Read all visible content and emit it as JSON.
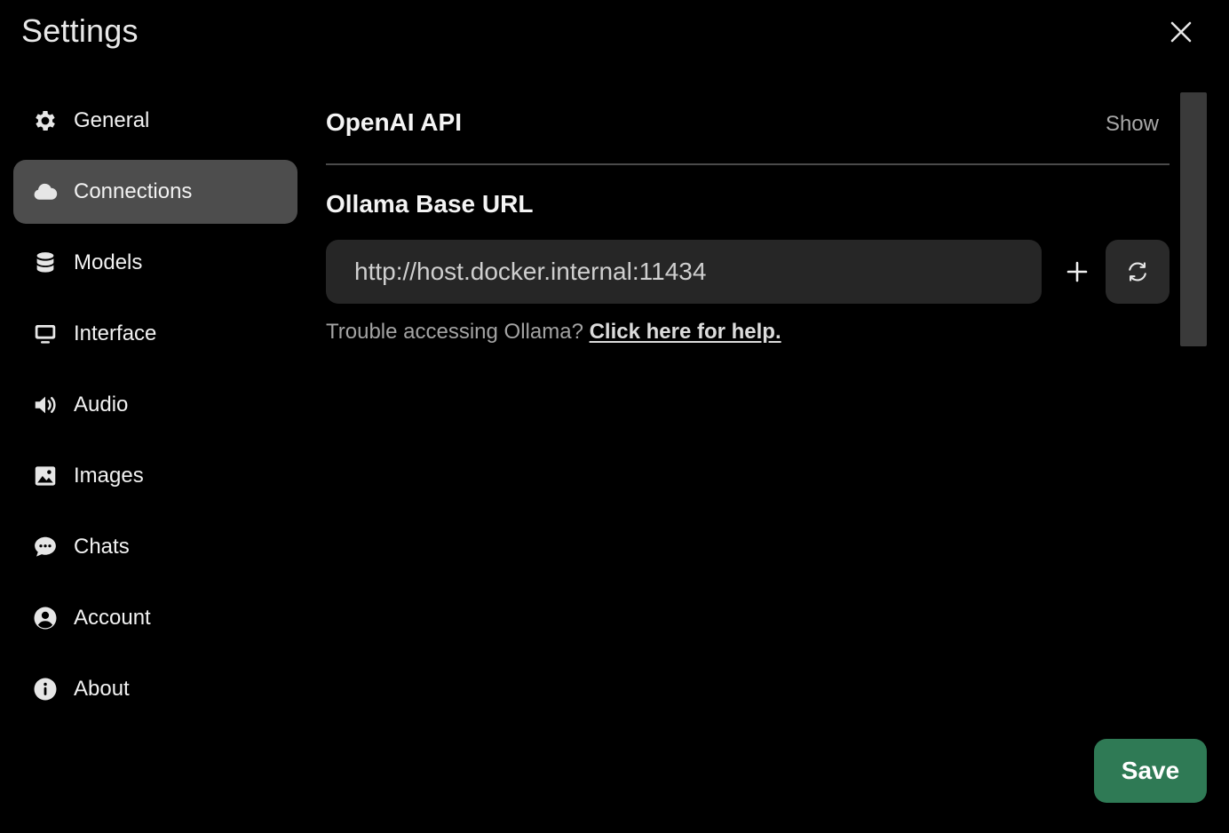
{
  "window": {
    "title": "Settings",
    "close_icon": "close-icon"
  },
  "sidebar": {
    "items": [
      {
        "label": "General",
        "icon": "gear-icon"
      },
      {
        "label": "Connections",
        "icon": "cloud-icon",
        "active": true
      },
      {
        "label": "Models",
        "icon": "database-icon"
      },
      {
        "label": "Interface",
        "icon": "monitor-icon"
      },
      {
        "label": "Audio",
        "icon": "speaker-icon"
      },
      {
        "label": "Images",
        "icon": "image-icon"
      },
      {
        "label": "Chats",
        "icon": "chat-bubble-icon"
      },
      {
        "label": "Account",
        "icon": "user-circle-icon"
      },
      {
        "label": "About",
        "icon": "info-icon"
      }
    ]
  },
  "main": {
    "openai": {
      "title": "OpenAI API",
      "toggle_label": "Show"
    },
    "ollama": {
      "title": "Ollama Base URL",
      "url_value": "http://host.docker.internal:11434",
      "add_icon": "plus-icon",
      "refresh_icon": "refresh-icon",
      "help_text": "Trouble accessing Ollama? ",
      "help_link": "Click here for help."
    }
  },
  "footer": {
    "save_label": "Save"
  },
  "colors": {
    "background": "#000000",
    "active_item": "#4d4d4d",
    "input_bg": "#262626",
    "save_button": "#2f7a55",
    "muted_text": "#a3a3a3"
  }
}
